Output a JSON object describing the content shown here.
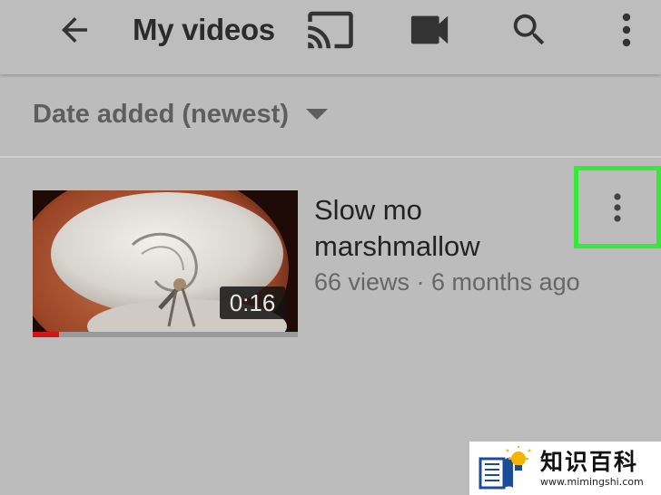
{
  "header": {
    "title": "My videos",
    "icons": [
      "back-arrow-icon",
      "cast-icon",
      "video-camera-icon",
      "search-icon",
      "more-vert-icon"
    ]
  },
  "sort": {
    "label": "Date added (newest)",
    "icon": "dropdown-triangle-icon"
  },
  "videos": [
    {
      "title": "Slow mo marshmallow",
      "meta": "66 views · 6 months ago",
      "duration": "0:16",
      "watched_fraction": 0.1
    }
  ],
  "watermark": {
    "cn": "知识百科",
    "url": "www.mimingshi.com"
  },
  "colors": {
    "background": "#bcbcbc",
    "highlight": "#37e937",
    "progress": "#d01818"
  }
}
